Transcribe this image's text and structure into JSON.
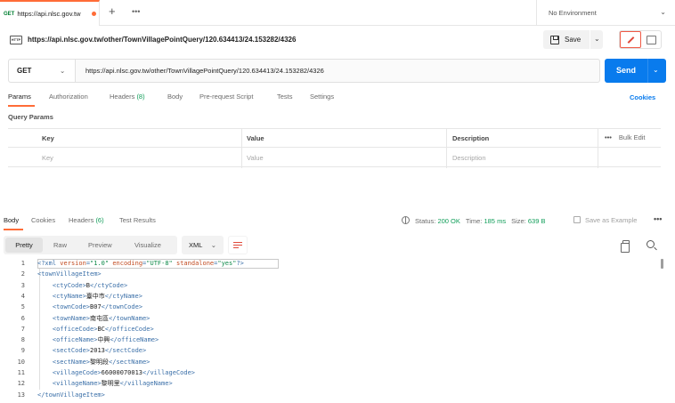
{
  "tab": {
    "method": "GET",
    "url": "https://api.nlsc.gov.tw"
  },
  "tab_actions": {
    "new": "+",
    "more": "•••"
  },
  "environment": {
    "label": "No Environment"
  },
  "request": {
    "title": "https://api.nlsc.gov.tw/other/TownVillagePointQuery/120.634413/24.153282/4326",
    "save_label": "Save",
    "method": "GET",
    "url": "https://api.nlsc.gov.tw/other/TownVillagePointQuery/120.634413/24.153282/4326",
    "send_label": "Send"
  },
  "request_tabs": [
    {
      "label": "Params",
      "active": true
    },
    {
      "label": "Authorization"
    },
    {
      "label": "Headers ",
      "count": "(8)"
    },
    {
      "label": "Body"
    },
    {
      "label": "Pre-request Script"
    },
    {
      "label": "Tests"
    },
    {
      "label": "Settings"
    }
  ],
  "cookies_label": "Cookies",
  "query_params": {
    "label": "Query Params",
    "headers": [
      "Key",
      "Value",
      "Description"
    ],
    "placeholders": [
      "Key",
      "Value",
      "Description"
    ],
    "bulk_edit": "Bulk Edit"
  },
  "response_tabs": [
    {
      "label": "Body",
      "active": true
    },
    {
      "label": "Cookies"
    },
    {
      "label": "Headers ",
      "count": "(6)"
    },
    {
      "label": "Test Results"
    }
  ],
  "response_status": {
    "status_label": "Status:",
    "status_value": "200 OK",
    "time_label": "Time:",
    "time_value": "185 ms",
    "size_label": "Size:",
    "size_value": "639 B",
    "save_example": "Save as Example"
  },
  "body_view": {
    "options": [
      "Pretty",
      "Raw",
      "Preview",
      "Visualize"
    ],
    "selected": "Pretty",
    "format": "XML"
  },
  "code_lines": [
    {
      "n": "1",
      "text": "<?xml version=\"1.0\" encoding=\"UTF-8\" standalone=\"yes\"?>"
    },
    {
      "n": "2",
      "text": "<townVillageItem>"
    },
    {
      "n": "3",
      "text": "    <ctyCode>B</ctyCode>"
    },
    {
      "n": "4",
      "text": "    <ctyName>臺中市</ctyName>"
    },
    {
      "n": "5",
      "text": "    <townCode>B07</townCode>"
    },
    {
      "n": "6",
      "text": "    <townName>南屯區</townName>"
    },
    {
      "n": "7",
      "text": "    <officeCode>BC</officeCode>"
    },
    {
      "n": "8",
      "text": "    <officeName>中興</officeName>"
    },
    {
      "n": "9",
      "text": "    <sectCode>2013</sectCode>"
    },
    {
      "n": "10",
      "text": "    <sectName>黎明段</sectName>"
    },
    {
      "n": "11",
      "text": "    <villageCode>66000070013</villageCode>"
    },
    {
      "n": "12",
      "text": "    <villageName>黎明里</villageName>"
    },
    {
      "n": "13",
      "text": "</townVillageItem>"
    }
  ],
  "colors": {
    "accent": "#ff6c37",
    "send": "#097bed",
    "success": "#0f9d58",
    "method_get": "#007f31"
  }
}
